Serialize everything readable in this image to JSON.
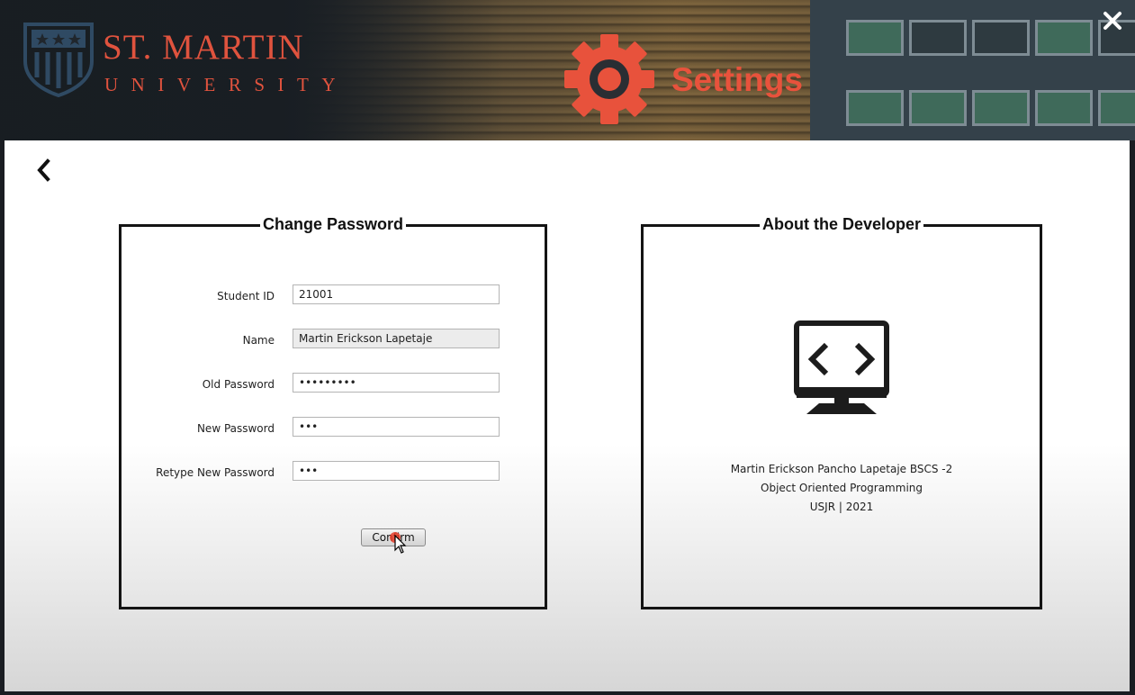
{
  "header": {
    "logo_line1": "ST. MARTIN",
    "logo_line2": "UNIVERSITY",
    "title": "Settings",
    "accent_color": "#e0533e",
    "icons": [
      "shield-logo-icon",
      "gear-icon",
      "close-icon"
    ]
  },
  "nav": {
    "back_icon": "chevron-left-icon"
  },
  "change_password": {
    "title": "Change Password",
    "fields": [
      {
        "label": "Student ID",
        "value": "21001"
      },
      {
        "label": "Name",
        "value": "Martin Erickson Lapetaje"
      },
      {
        "label": "Old Password",
        "value": "•••••••••"
      },
      {
        "label": "New Password",
        "value": "•••"
      },
      {
        "label": "Retype New Password",
        "value": "•••"
      }
    ],
    "confirm_label": "Confirm"
  },
  "about": {
    "title": "About the Developer",
    "icon": "code-monitor-icon",
    "lines": [
      "Martin Erickson Pancho Lapetaje BSCS -2",
      "Object Oriented Programming",
      "USJR | 2021"
    ]
  }
}
